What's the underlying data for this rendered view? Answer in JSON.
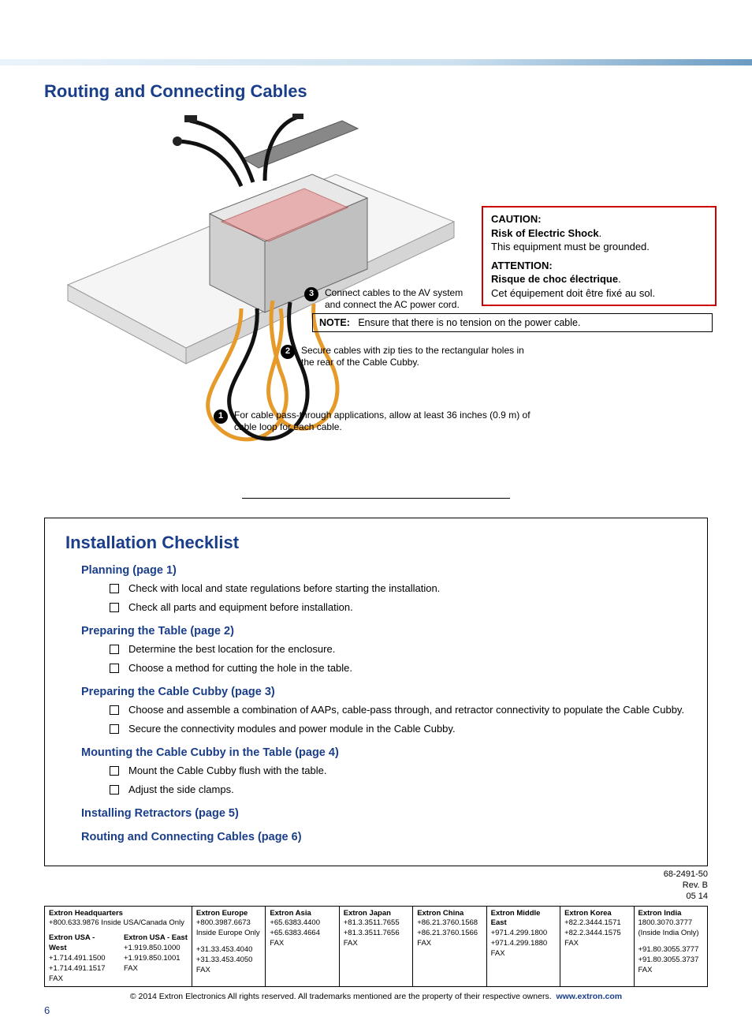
{
  "section_title": "Routing and Connecting Cables",
  "callouts": {
    "c1": {
      "num": "1",
      "text": "For cable pass-through applications, allow at least 36 inches (0.9 m) of cable loop for each cable."
    },
    "c2": {
      "num": "2",
      "text": "Secure cables with zip ties to the rectangular holes in the rear of the Cable Cubby."
    },
    "c3": {
      "num": "3",
      "text": "Connect cables to the AV system and connect the AC power cord."
    }
  },
  "caution": {
    "label": "CAUTION:",
    "headline": "Risk of Electric Shock",
    "body": "This equipment must be grounded.",
    "label_fr": "ATTENTION:",
    "headline_fr": "Risque de choc électrique",
    "body_fr": "Cet équipement doit être fixé au sol."
  },
  "note": {
    "label": "NOTE:",
    "text": "Ensure that there is no tension on the power cable."
  },
  "checklist": {
    "title": "Installation Checklist",
    "sections": [
      {
        "heading": "Planning (page 1)",
        "items": [
          "Check with local and state regulations before starting the installation.",
          "Check all parts and equipment before installation."
        ]
      },
      {
        "heading": "Preparing the Table (page 2)",
        "items": [
          "Determine the best location for the enclosure.",
          "Choose a method for cutting the hole in the table."
        ]
      },
      {
        "heading": "Preparing the Cable Cubby (page 3)",
        "items": [
          "Choose and assemble a combination of AAPs, cable-pass through, and retractor connectivity to populate the Cable Cubby.",
          "Secure the connectivity modules and power module in the Cable Cubby."
        ]
      },
      {
        "heading": "Mounting the Cable Cubby in the Table (page 4)",
        "items": [
          "Mount the Cable Cubby flush with the table.",
          "Adjust the side clamps."
        ]
      },
      {
        "heading": "Installing Retractors (page 5)",
        "items": []
      },
      {
        "heading": "Routing and Connecting Cables (page 6)",
        "items": []
      }
    ]
  },
  "meta": {
    "docnum": "68-2491-50",
    "rev": "Rev. B",
    "date": "05 14"
  },
  "offices": [
    {
      "name": "Extron Headquarters",
      "l1": "+800.633.9876 Inside USA/Canada Only",
      "sub": [
        {
          "name": "Extron USA - West",
          "l1": "+1.714.491.1500",
          "l2": "+1.714.491.1517 FAX"
        },
        {
          "name": "Extron USA - East",
          "l1": "+1.919.850.1000",
          "l2": "+1.919.850.1001 FAX"
        }
      ]
    },
    {
      "name": "Extron Europe",
      "l1": "+800.3987.6673",
      "l2": "Inside Europe Only",
      "l3": "+31.33.453.4040",
      "l4": "+31.33.453.4050 FAX"
    },
    {
      "name": "Extron Asia",
      "l1": "+65.6383.4400",
      "l2": "+65.6383.4664 FAX"
    },
    {
      "name": "Extron Japan",
      "l1": "+81.3.3511.7655",
      "l2": "+81.3.3511.7656 FAX"
    },
    {
      "name": "Extron China",
      "l1": "+86.21.3760.1568",
      "l2": "+86.21.3760.1566 FAX"
    },
    {
      "name": "Extron Middle East",
      "l1": "+971.4.299.1800",
      "l2": "+971.4.299.1880 FAX"
    },
    {
      "name": "Extron Korea",
      "l1": "+82.2.3444.1571",
      "l2": "+82.2.3444.1575 FAX"
    },
    {
      "name": "Extron India",
      "l1": "1800.3070.3777",
      "l2": "(Inside India Only)",
      "l3": "+91.80.3055.3777",
      "l4": "+91.80.3055.3737 FAX"
    }
  ],
  "copyright": {
    "text": "© 2014 Extron Electronics   All rights reserved.  All trademarks mentioned are the property of their respective owners.",
    "link": "www.extron.com"
  },
  "page_number": "6"
}
